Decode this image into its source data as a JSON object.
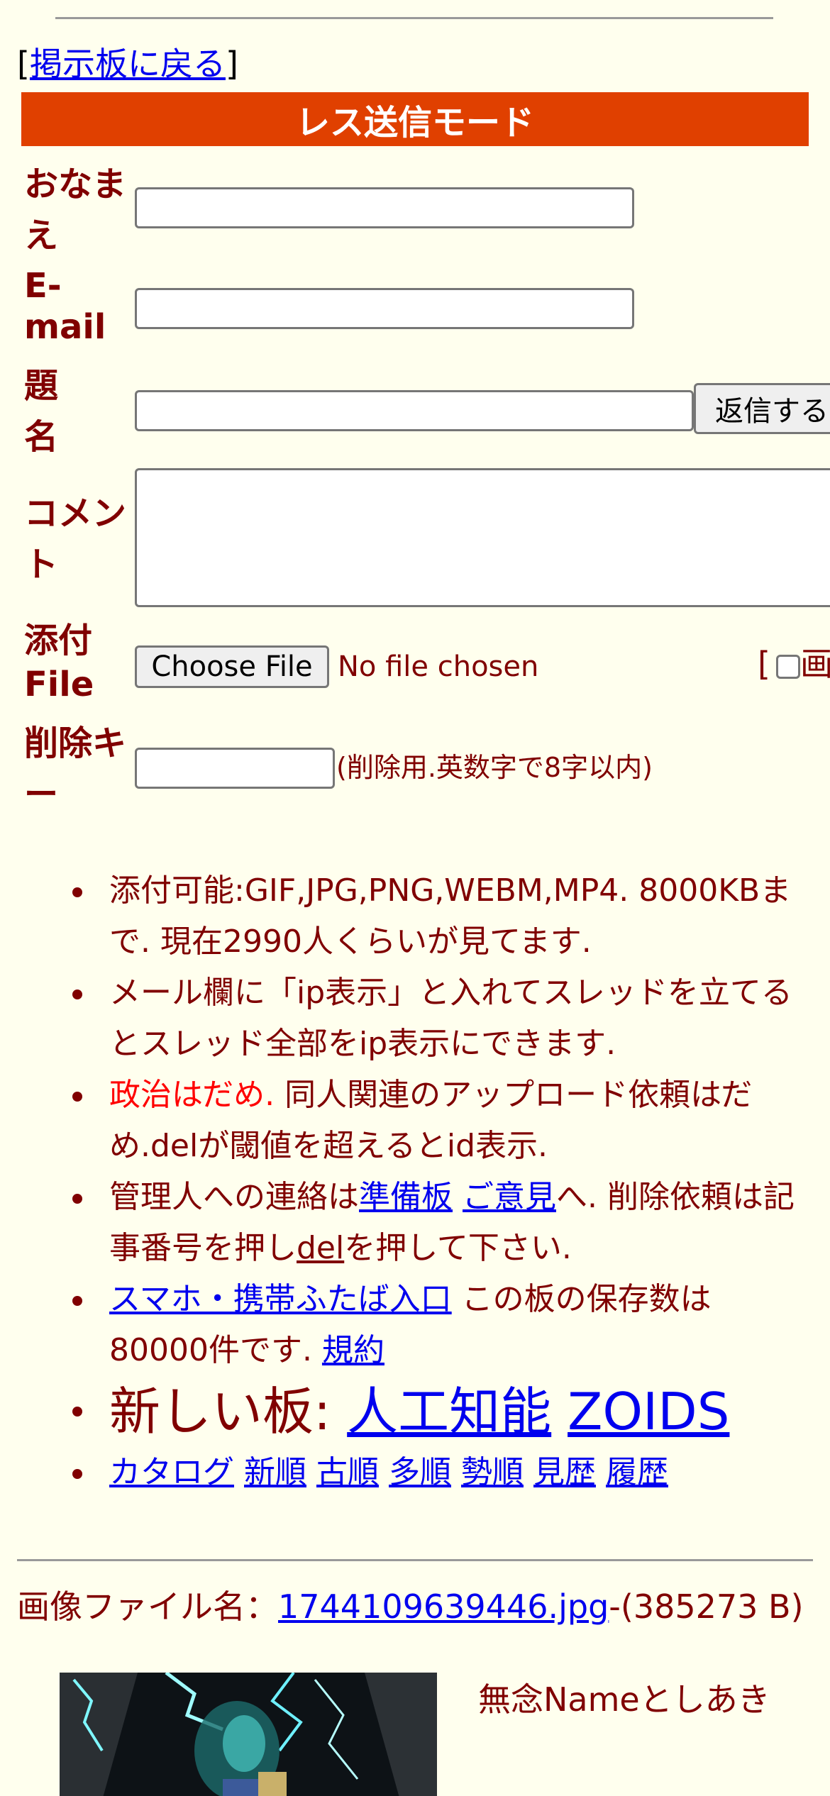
{
  "nav": {
    "back_open": "[",
    "back_label": "掲示板に戻る",
    "back_close": "]"
  },
  "form": {
    "mode_title": "レス送信モード",
    "name_label_1": "おなま",
    "name_label_2": "え",
    "email_label_1": "E-",
    "email_label_2": "mail",
    "subject_label_1": "題",
    "subject_label_2": "名",
    "submit_label": "返信する",
    "comment_label_1": "コメン",
    "comment_label_2": "ト",
    "file_label_1": "添付",
    "file_label_2": "File",
    "choose_file_label": "Choose File",
    "no_file_text": "No file chosen",
    "image_toggle_bracket": "[",
    "image_toggle_text": "画",
    "delkey_label_1": "削除キ",
    "delkey_label_2": "ー",
    "delkey_hint": "(削除用.英数字で8字以内)"
  },
  "notes": {
    "n1": "添付可能:GIF,JPG,PNG,WEBM,MP4. 8000KBまで. 現在2990人くらいが見てます.",
    "n2": "メール欄に「ip表示」と入れてスレッドを立てるとスレッド全部をip表示にできます.",
    "n3_red": "政治はだめ.",
    "n3_rest": " 同人関連のアップロード依頼はだめ.delが閾値を超えるとid表示.",
    "n4_a": "管理人への連絡は",
    "n4_link1": "準備板",
    "n4_link2": "ご意見",
    "n4_b": "へ. 削除依頼は記事番号を押し",
    "n4_link3": "del",
    "n4_c": "を押して下さい.",
    "n5_link": "スマホ・携帯ふたば入口",
    "n5_text": " この板の保存数は80000件です. ",
    "n5_link2": "規約",
    "n6_text": "新しい板: ",
    "n6_link1": "人工知能",
    "n6_link2": "ZOIDS",
    "sort_links": [
      "カタログ",
      "新順",
      "古順",
      "多順",
      "勢順",
      "見歴",
      "履歴"
    ]
  },
  "post": {
    "file_prefix": "画像ファイル名：",
    "file_name": "1744109639446.jpg",
    "file_size": "-(385273 B)",
    "name_text": "無念Nameとしあき"
  }
}
